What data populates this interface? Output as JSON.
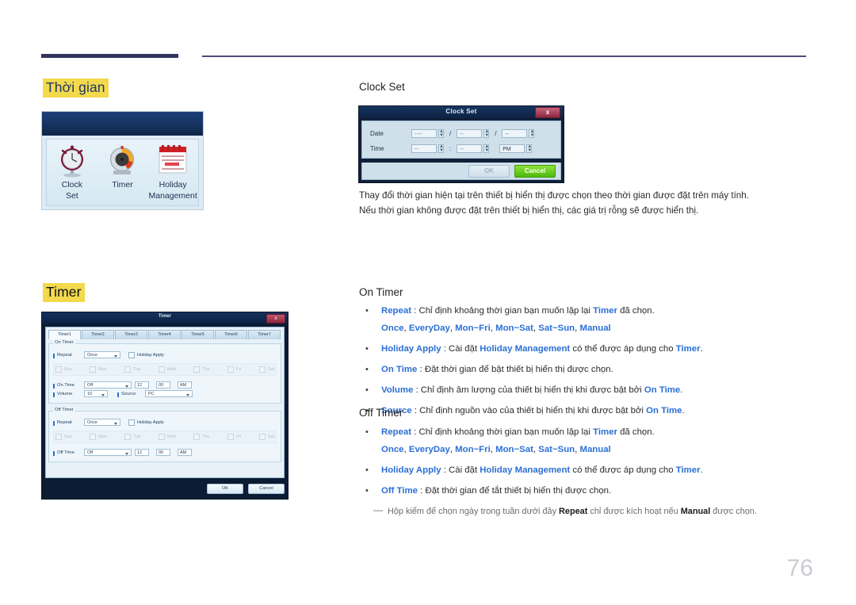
{
  "page_number": "76",
  "sections": {
    "time": {
      "heading": "Thời gian",
      "panel": {
        "icons": [
          {
            "name": "clock-set-icon",
            "caption_line1": "Clock",
            "caption_line2": "Set"
          },
          {
            "name": "timer-icon",
            "caption_line1": "Timer",
            "caption_line2": ""
          },
          {
            "name": "holiday-management-icon",
            "caption_line1": "Holiday",
            "caption_line2": "Management"
          }
        ]
      }
    },
    "timer": {
      "heading": "Timer"
    }
  },
  "clock_set": {
    "title": "Clock Set",
    "dialog": {
      "titlebar": "Clock Set",
      "close_label": "x",
      "date_label": "Date",
      "time_label": "Time",
      "date_year": "----",
      "date_month": "--",
      "date_day": "--",
      "time_hour": "--",
      "time_minute": "--",
      "time_meridiem": "PM",
      "slash": "/",
      "colon": ":",
      "ok_label": "OK",
      "cancel_label": "Cancel"
    },
    "paragraphs": [
      "Thay đổi thời gian hiện tại trên thiết bị hiển thị được chọn theo thời gian được đặt trên máy tính.",
      "Nếu thời gian không được đặt trên thiết bị hiển thị, các giá trị rỗng sẽ được hiển thị."
    ]
  },
  "timer_dialog": {
    "titlebar": "Timer",
    "close_label": "x",
    "tabs": [
      "Timer1",
      "Timer2",
      "Timer3",
      "Timer4",
      "Timer5",
      "Timer6",
      "Timer7"
    ],
    "active_tab": "Timer1",
    "on_group": {
      "legend": "On Timer",
      "repeat_label": "Repeat",
      "repeat_value": "Once",
      "holiday_apply_label": "Holiday Apply",
      "days": [
        "Sun",
        "Mon",
        "Tue",
        "Wed",
        "Thu",
        "Fri",
        "Sat"
      ],
      "time_label": "On Time",
      "time_mode": "Off",
      "hour": "12",
      "minute": "00",
      "meridiem": "AM",
      "volume_label": "Volume",
      "volume_value": "10",
      "source_label": "Source",
      "source_value": "PC"
    },
    "off_group": {
      "legend": "Off Timer",
      "repeat_label": "Repeat",
      "repeat_value": "Once",
      "holiday_apply_label": "Holiday Apply",
      "days": [
        "Sun",
        "Mon",
        "Tue",
        "Wed",
        "Thu",
        "Fri",
        "Sat"
      ],
      "time_label": "Off Time",
      "time_mode": "Off",
      "hour": "12",
      "minute": "00",
      "meridiem": "AM"
    },
    "ok_label": "OK",
    "cancel_label": "Cancel"
  },
  "on_timer": {
    "title": "On Timer",
    "items": [
      {
        "kw": "Repeat",
        "text_after": " : Chỉ định khoảng thời gian bạn muốn lặp lại ",
        "kw2": "Timer",
        "tail": " đã chọn.",
        "options": [
          "Once",
          "EveryDay",
          "Mon~Fri",
          "Mon~Sat",
          "Sat~Sun",
          "Manual"
        ]
      },
      {
        "kw": "Holiday Apply",
        "text_after": " : Cài đặt ",
        "kw2": "Holiday Management",
        "mid": " có thể được áp dụng cho ",
        "kw3": "Timer",
        "tail": "."
      },
      {
        "kw": "On Time",
        "text_after": " : Đặt thời gian để bật thiết bị hiển thị được chọn."
      },
      {
        "kw": "Volume",
        "text_after": " : Chỉ định âm lượng của thiết bị hiển thị khi được bật bởi ",
        "kw2": "On Time",
        "tail": "."
      },
      {
        "kw": "Source",
        "text_after": " : Chỉ định nguồn vào của thiết bị hiển thị khi được bật bởi ",
        "kw2": "On Time",
        "tail": "."
      }
    ]
  },
  "off_timer": {
    "title": "Off Timer",
    "items": [
      {
        "kw": "Repeat",
        "text_after": " : Chỉ định khoảng thời gian bạn muốn lặp lại ",
        "kw2": "Timer",
        "tail": " đã chọn.",
        "options": [
          "Once",
          "EveryDay",
          "Mon~Fri",
          "Mon~Sat",
          "Sat~Sun",
          "Manual"
        ]
      },
      {
        "kw": "Holiday Apply",
        "text_after": " : Cài đặt ",
        "kw2": "Holiday Management",
        "mid": " có thể được áp dụng cho ",
        "kw3": "Timer",
        "tail": "."
      },
      {
        "kw": "Off Time",
        "text_after": " : Đặt thời gian để tắt thiết bị hiển thị được chọn."
      }
    ],
    "note": {
      "pre": "Hộp kiểm để chọn ngày trong tuần dưới đây ",
      "b1": "Repeat",
      "mid": " chỉ được kích hoạt nếu ",
      "b2": "Manual",
      "tail": " được chọn."
    }
  },
  "colors": {
    "highlight": "#f2da4c",
    "keyword_blue": "#2b6fd4",
    "rule_navy": "#31355e",
    "cancel_green": "#4cb80d"
  }
}
